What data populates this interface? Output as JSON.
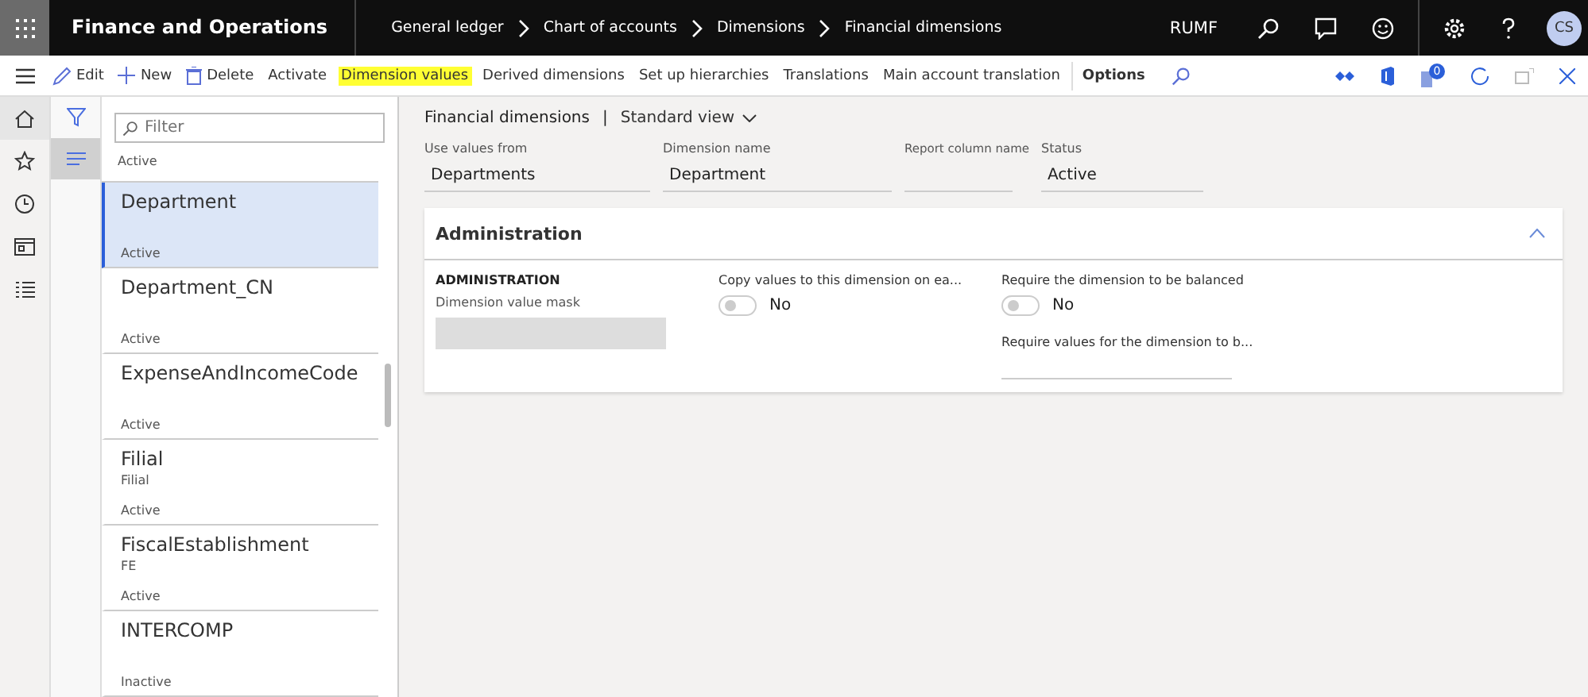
{
  "app": {
    "title": "Finance and Operations"
  },
  "breadcrumb": [
    "General ledger",
    "Chart of accounts",
    "Dimensions",
    "Financial dimensions"
  ],
  "company": "RUMF",
  "user": {
    "initials": "CS"
  },
  "toolbar": {
    "actions": [
      {
        "label": "Edit",
        "kind": "edit",
        "highlighted": false
      },
      {
        "label": "New",
        "kind": "new",
        "highlighted": false
      },
      {
        "label": "Delete",
        "kind": "delete",
        "highlighted": false
      },
      {
        "label": "Activate",
        "kind": "text",
        "highlighted": false
      },
      {
        "label": "Dimension values",
        "kind": "text",
        "highlighted": true
      },
      {
        "label": "Derived dimensions",
        "kind": "text",
        "highlighted": false
      },
      {
        "label": "Set up hierarchies",
        "kind": "text",
        "highlighted": false
      },
      {
        "label": "Translations",
        "kind": "text",
        "highlighted": false
      },
      {
        "label": "Main account translation",
        "kind": "text",
        "highlighted": false
      }
    ],
    "options": "Options",
    "notification_count": "0"
  },
  "list": {
    "filter_placeholder": "Filter",
    "partial_top_status": "Active",
    "items": [
      {
        "name": "Department",
        "status": "Active",
        "selected": true
      },
      {
        "name": "Department_CN",
        "status": "Active",
        "selected": false
      },
      {
        "name": "ExpenseAndIncomeCode",
        "status": "Active",
        "selected": false
      },
      {
        "name": "Filial",
        "description": "Filial",
        "status": "Active",
        "selected": false
      },
      {
        "name": "FiscalEstablishment",
        "description": "FE",
        "status": "Active",
        "selected": false
      },
      {
        "name": "INTERCOMP",
        "status": "Inactive",
        "selected": false
      }
    ]
  },
  "header": {
    "title": "Financial dimensions",
    "separator": "|",
    "view": "Standard view"
  },
  "fields": [
    {
      "label": "Use values from",
      "value": "Departments"
    },
    {
      "label": "Dimension name",
      "value": "Department"
    },
    {
      "label": "Report column name"
    },
    {
      "label": "Status",
      "value": "Active"
    }
  ],
  "section": {
    "title": "Administration",
    "expanded": true,
    "group_title": "ADMINISTRATION",
    "mask_label": "Dimension value mask",
    "toggles": [
      {
        "label": "Copy values to this dimension on ea...",
        "state_text": "No",
        "on": false
      },
      {
        "label": "Require the dimension to be balanced",
        "state_text": "No",
        "on": false
      }
    ],
    "require_label": "Require values for the dimension to b..."
  }
}
